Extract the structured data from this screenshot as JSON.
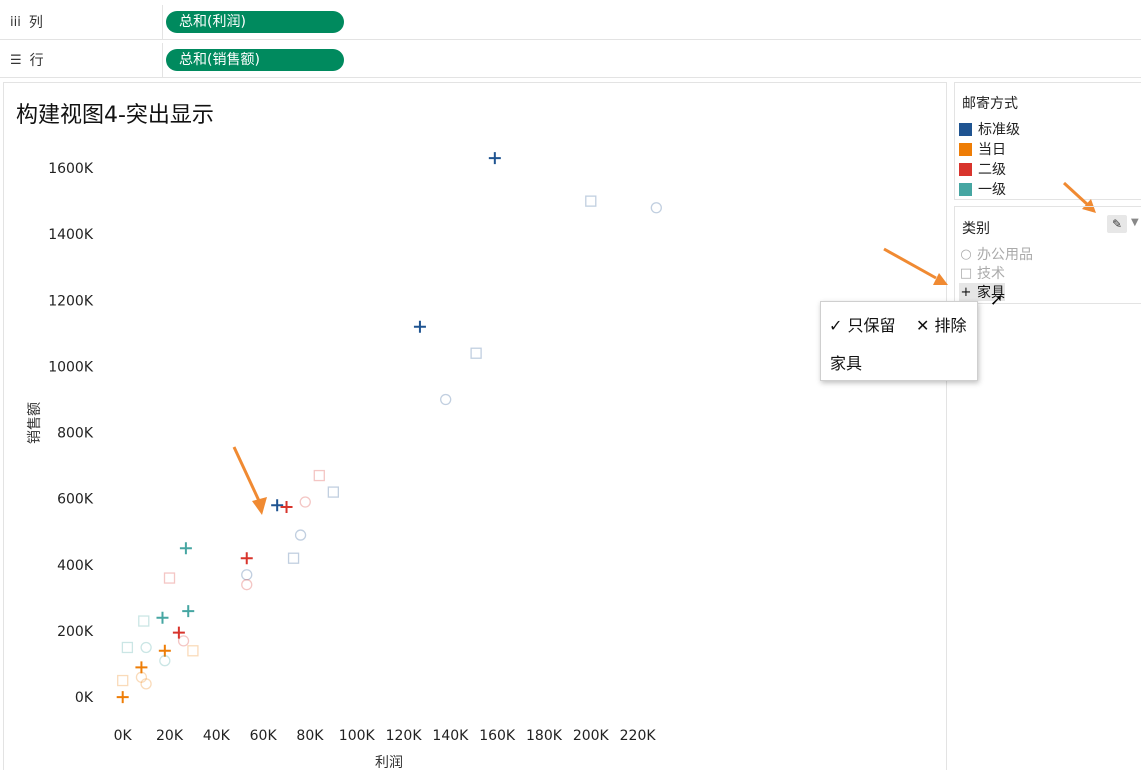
{
  "shelves": {
    "columns": {
      "icon": "iii",
      "label": "列",
      "pill": "总和(利润)"
    },
    "rows": {
      "icon": "☰",
      "label": "行",
      "pill": "总和(销售额)"
    }
  },
  "view": {
    "title": "构建视图4-突出显示"
  },
  "legend": {
    "title": "邮寄方式",
    "items": [
      {
        "label": "标准级",
        "color": "#1f5491"
      },
      {
        "label": "当日",
        "color": "#ee7d06"
      },
      {
        "label": "二级",
        "color": "#d8342c"
      },
      {
        "label": "一级",
        "color": "#46a6a2"
      }
    ]
  },
  "shape_filter": {
    "title": "类别",
    "edit_icon": "pen-icon",
    "items": [
      {
        "glyph": "○",
        "label": "办公用品",
        "dimmed": true
      },
      {
        "glyph": "□",
        "label": "技术",
        "dimmed": true
      },
      {
        "glyph": "+",
        "label": "家具",
        "dimmed": false
      }
    ]
  },
  "context_menu": {
    "keep_only": "✓ 只保留",
    "exclude": "✕ 排除",
    "item": "家具"
  },
  "chart_data": {
    "type": "scatter",
    "xlabel": "利润",
    "ylabel": "销售额",
    "xlim": [
      -5,
      230
    ],
    "ylim": [
      -30,
      1700
    ],
    "x_ticks": [
      0,
      20,
      40,
      60,
      80,
      100,
      120,
      140,
      160,
      180,
      200,
      220
    ],
    "x_tick_labels": [
      "0K",
      "20K",
      "40K",
      "60K",
      "80K",
      "100K",
      "120K",
      "140K",
      "160K",
      "180K",
      "200K",
      "220K"
    ],
    "y_ticks": [
      0,
      200,
      400,
      600,
      800,
      1000,
      1200,
      1400,
      1600
    ],
    "y_tick_labels": [
      "0K",
      "200K",
      "400K",
      "600K",
      "800K",
      "1000K",
      "1200K",
      "1400K",
      "1600K"
    ],
    "series": [
      {
        "category": "家具",
        "shape": "plus",
        "color": "#1f5491",
        "x": [
          159,
          127,
          66
        ],
        "y": [
          1630,
          1120,
          580
        ]
      },
      {
        "category": "家具",
        "shape": "plus",
        "color": "#d8342c",
        "x": [
          70,
          53,
          24
        ],
        "y": [
          575,
          420,
          195
        ]
      },
      {
        "category": "家具",
        "shape": "plus",
        "color": "#46a6a2",
        "x": [
          27,
          28,
          17
        ],
        "y": [
          450,
          260,
          240
        ]
      },
      {
        "category": "家具",
        "shape": "plus",
        "color": "#ee7d06",
        "x": [
          0,
          8,
          18
        ],
        "y": [
          0,
          90,
          140
        ]
      },
      {
        "category": "办公用品",
        "shape": "circle",
        "color": "#1f5491",
        "x": [
          228,
          138,
          76,
          53
        ],
        "y": [
          1480,
          900,
          490,
          370
        ]
      },
      {
        "category": "办公用品",
        "shape": "circle",
        "color": "#d8342c",
        "x": [
          78,
          53,
          26
        ],
        "y": [
          590,
          340,
          170
        ]
      },
      {
        "category": "办公用品",
        "shape": "circle",
        "color": "#46a6a2",
        "x": [
          10,
          18
        ],
        "y": [
          150,
          110
        ]
      },
      {
        "category": "办公用品",
        "shape": "circle",
        "color": "#ee7d06",
        "x": [
          8,
          10
        ],
        "y": [
          60,
          40
        ]
      },
      {
        "category": "技术",
        "shape": "square",
        "color": "#1f5491",
        "x": [
          200,
          151,
          90,
          73
        ],
        "y": [
          1500,
          1040,
          620,
          420
        ]
      },
      {
        "category": "技术",
        "shape": "square",
        "color": "#d8342c",
        "x": [
          84,
          20
        ],
        "y": [
          670,
          360
        ]
      },
      {
        "category": "技术",
        "shape": "square",
        "color": "#46a6a2",
        "x": [
          9,
          2
        ],
        "y": [
          230,
          150
        ]
      },
      {
        "category": "技术",
        "shape": "square",
        "color": "#ee7d06",
        "x": [
          30,
          0
        ],
        "y": [
          140,
          50
        ]
      }
    ]
  }
}
